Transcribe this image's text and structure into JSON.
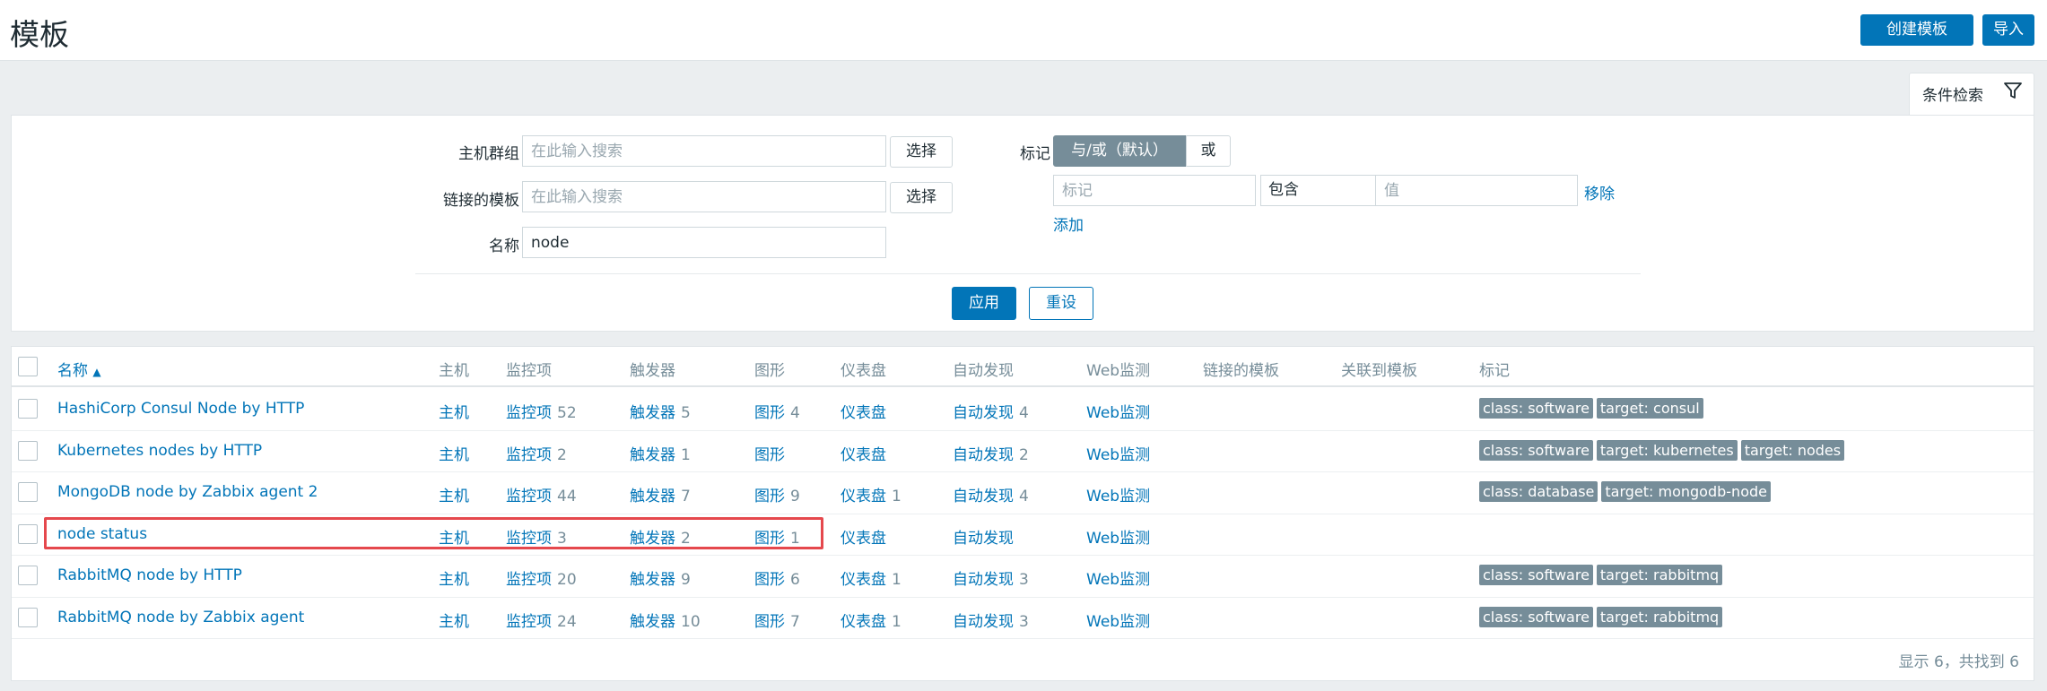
{
  "header": {
    "title": "模板",
    "create_button": "创建模板",
    "import_button": "导入"
  },
  "filter_tab": {
    "label": "条件检索",
    "icon": "filter-icon"
  },
  "filter": {
    "host_groups": {
      "label": "主机群组",
      "placeholder": "在此输入搜索",
      "select": "选择"
    },
    "linked_templates": {
      "label": "链接的模板",
      "placeholder": "在此输入搜索",
      "select": "选择"
    },
    "name": {
      "label": "名称",
      "value": "node"
    },
    "tags": {
      "label": "标记",
      "mode_and_or": "与/或（默认）",
      "mode_or": "或",
      "tag_placeholder": "标记",
      "operator": "包含",
      "value_placeholder": "值",
      "remove": "移除",
      "add": "添加"
    },
    "apply": "应用",
    "reset": "重设"
  },
  "table": {
    "columns": {
      "name": "名称",
      "hosts": "主机",
      "items": "监控项",
      "triggers": "触发器",
      "graphs": "图形",
      "dashboards": "仪表盘",
      "discovery": "自动发现",
      "web": "Web监测",
      "linked": "链接的模板",
      "linked_to": "关联到模板",
      "tags": "标记"
    },
    "rows": [
      {
        "name": "HashiCorp Consul Node by HTTP",
        "hosts": "主机",
        "items": "监控项",
        "items_count": "52",
        "triggers": "触发器",
        "triggers_count": "5",
        "graphs": "图形",
        "graphs_count": "4",
        "dashboards": "仪表盘",
        "dashboards_count": "",
        "discovery": "自动发现",
        "discovery_count": "4",
        "web": "Web监测",
        "tags": [
          "class: software",
          "target: consul"
        ]
      },
      {
        "name": "Kubernetes nodes by HTTP",
        "hosts": "主机",
        "items": "监控项",
        "items_count": "2",
        "triggers": "触发器",
        "triggers_count": "1",
        "graphs": "图形",
        "graphs_count": "",
        "dashboards": "仪表盘",
        "dashboards_count": "",
        "discovery": "自动发现",
        "discovery_count": "2",
        "web": "Web监测",
        "tags": [
          "class: software",
          "target: kubernetes",
          "target: nodes"
        ]
      },
      {
        "name": "MongoDB node by Zabbix agent 2",
        "hosts": "主机",
        "items": "监控项",
        "items_count": "44",
        "triggers": "触发器",
        "triggers_count": "7",
        "graphs": "图形",
        "graphs_count": "9",
        "dashboards": "仪表盘",
        "dashboards_count": "1",
        "discovery": "自动发现",
        "discovery_count": "4",
        "web": "Web监测",
        "tags": [
          "class: database",
          "target: mongodb-node"
        ]
      },
      {
        "name": "node status",
        "hosts": "主机",
        "items": "监控项",
        "items_count": "3",
        "triggers": "触发器",
        "triggers_count": "2",
        "graphs": "图形",
        "graphs_count": "1",
        "dashboards": "仪表盘",
        "dashboards_count": "",
        "discovery": "自动发现",
        "discovery_count": "",
        "web": "Web监测",
        "tags": []
      },
      {
        "name": "RabbitMQ node by HTTP",
        "hosts": "主机",
        "items": "监控项",
        "items_count": "20",
        "triggers": "触发器",
        "triggers_count": "9",
        "graphs": "图形",
        "graphs_count": "6",
        "dashboards": "仪表盘",
        "dashboards_count": "1",
        "discovery": "自动发现",
        "discovery_count": "3",
        "web": "Web监测",
        "tags": [
          "class: software",
          "target: rabbitmq"
        ]
      },
      {
        "name": "RabbitMQ node by Zabbix agent",
        "hosts": "主机",
        "items": "监控项",
        "items_count": "24",
        "triggers": "触发器",
        "triggers_count": "10",
        "graphs": "图形",
        "graphs_count": "7",
        "dashboards": "仪表盘",
        "dashboards_count": "1",
        "discovery": "自动发现",
        "discovery_count": "3",
        "web": "Web监测",
        "tags": [
          "class: software",
          "target: rabbitmq"
        ]
      }
    ],
    "footer": "显示 6，共找到 6"
  },
  "colors": {
    "accent": "#0275b8",
    "tag_bg": "#768d99",
    "highlight": "#e5484d"
  }
}
